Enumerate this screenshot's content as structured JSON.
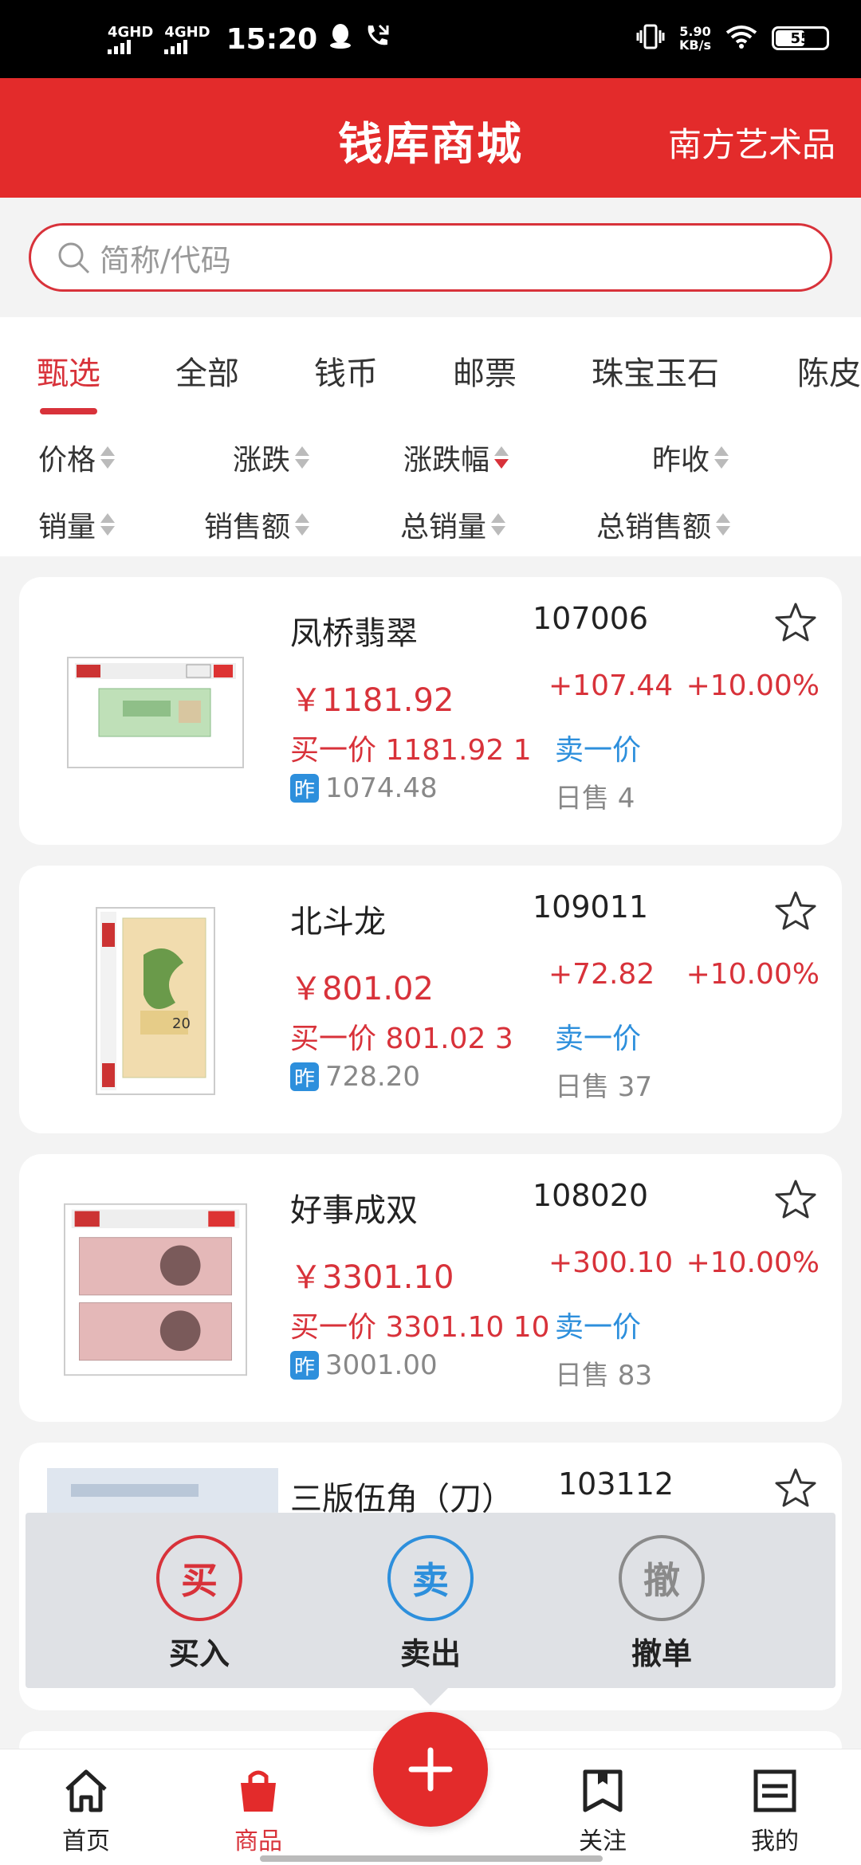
{
  "status_bar": {
    "sig1": "4GHD",
    "sig2": "4GHD",
    "time": "15:20",
    "net_speed_value": "5.90",
    "net_speed_unit": "KB/s",
    "battery": "55"
  },
  "header": {
    "title": "钱库商城",
    "right_link": "南方艺术品"
  },
  "search": {
    "placeholder": "简称/代码"
  },
  "tabs": [
    {
      "label": "甄选",
      "active": true
    },
    {
      "label": "全部"
    },
    {
      "label": "钱币"
    },
    {
      "label": "邮票"
    },
    {
      "label": "珠宝玉石"
    },
    {
      "label": "陈皮"
    }
  ],
  "sorts": {
    "row1": [
      "价格",
      "涨跌",
      "涨跌幅",
      "昨收"
    ],
    "row2": [
      "销量",
      "销售额",
      "总销量",
      "总销售额"
    ]
  },
  "products": [
    {
      "name": "凤桥翡翠",
      "code": "107006",
      "price": "￥1181.92",
      "change": "+107.44",
      "pct": "+10.00%",
      "buy1": "买一价 1181.92  1",
      "sell1": "卖一价",
      "zuo": "昨",
      "prev": "1074.48",
      "daily": "日售 4"
    },
    {
      "name": "北斗龙",
      "code": "109011",
      "price": "￥801.02",
      "change": "+72.82",
      "pct": "+10.00%",
      "buy1": "买一价 801.02  3",
      "sell1": "卖一价",
      "zuo": "昨",
      "prev": "728.20",
      "daily": "日售 37"
    },
    {
      "name": "好事成双",
      "code": "108020",
      "price": "￥3301.10",
      "change": "+300.10",
      "pct": "+10.00%",
      "buy1": "买一价 3301.10  10",
      "sell1": "卖一价",
      "zuo": "昨",
      "prev": "3001.00",
      "daily": "日售 83"
    },
    {
      "name": "三版伍角（刀）",
      "code": "103112"
    }
  ],
  "actions": [
    {
      "glyph": "买",
      "label": "买入",
      "color": "#d8323a"
    },
    {
      "glyph": "卖",
      "label": "卖出",
      "color": "#2d8fdc"
    },
    {
      "glyph": "撤",
      "label": "撤单",
      "color": "#8a8a8a"
    }
  ],
  "bottom_nav": [
    {
      "label": "首页",
      "icon": "home-icon"
    },
    {
      "label": "商品",
      "icon": "shopping-bag-icon",
      "active": true
    },
    {
      "label": "关注",
      "icon": "bookmark-icon"
    },
    {
      "label": "我的",
      "icon": "menu-list-icon"
    }
  ],
  "colors": {
    "brand_red": "#e32b2b",
    "price_red": "#d8323a",
    "sell_blue": "#2d8fdc"
  }
}
